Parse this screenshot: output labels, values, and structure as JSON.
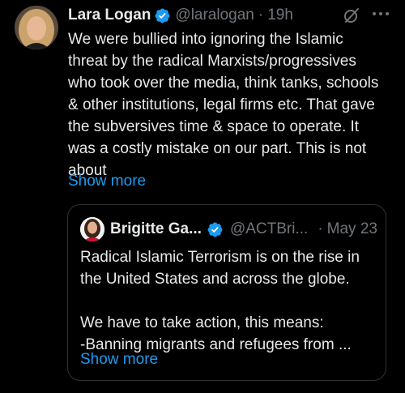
{
  "tweet": {
    "author_name": "Lara Logan",
    "handle": "@laralogan",
    "separator": "·",
    "time": "19h",
    "text": "We were bullied into ignoring the Islamic\nthreat by the radical Marxists/progressives\nwho took over the media, think tanks, schools\n& other institutions, legal firms etc. That gave\nthe subversives time & space to operate. It\nwas a costly mistake on our part. This is not\nabout",
    "show_more": "Show more"
  },
  "quote": {
    "author_name": "Brigitte Ga...",
    "handle": "@ACTBri...",
    "separator": "·",
    "time": "May 23",
    "text": "Radical Islamic Terrorism is on the rise in\nthe United States and across the globe.\n\nWe have to take action, this means:\n-Banning migrants and refugees from ...",
    "show_more": "Show more"
  },
  "icons": {
    "verified": "verified-badge-icon",
    "grok": "grok-icon",
    "more": "more-options-icon"
  },
  "colors": {
    "background": "#000000",
    "text": "#e7e9ea",
    "secondary_text": "#71767b",
    "link": "#1d9bf0",
    "border": "#2f3336"
  }
}
